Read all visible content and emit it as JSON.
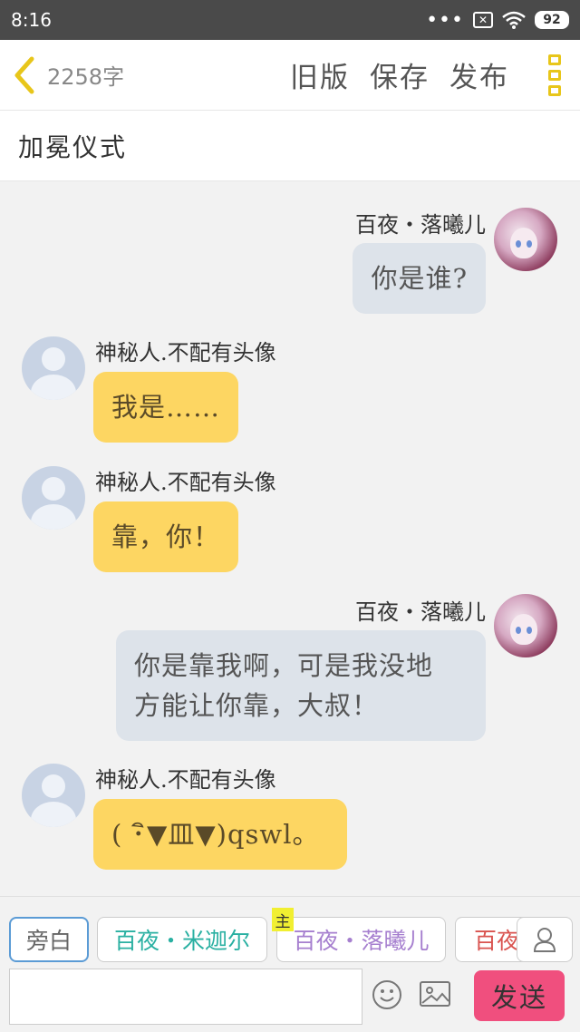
{
  "status_bar": {
    "time": "8:16",
    "battery": "92"
  },
  "header": {
    "word_count": "2258字",
    "old_version": "旧版",
    "save": "保存",
    "publish": "发布"
  },
  "title": "加冕仪式",
  "messages": [
    {
      "side": "right",
      "speaker": "百夜・落曦儿",
      "text": "你是谁?"
    },
    {
      "side": "left",
      "speaker": "神秘人.不配有头像",
      "text": "我是……"
    },
    {
      "side": "left",
      "speaker": "神秘人.不配有头像",
      "text": "靠，你！"
    },
    {
      "side": "right",
      "speaker": "百夜・落曦儿",
      "text_line1": "你是靠我啊，可是我没地",
      "text_line2": "方能让你靠，大叔！"
    },
    {
      "side": "left",
      "speaker": "神秘人.不配有头像",
      "text": "( ･ิ▼皿▼)qswl。"
    }
  ],
  "roles": {
    "narration": "旁白",
    "role_a": "百夜・米迦尔",
    "role_b": "百夜・落曦儿",
    "role_c": "百夜",
    "main_tag": "主"
  },
  "input": {
    "placeholder": "",
    "send": "发送"
  },
  "colors": {
    "accent_yellow": "#e8c61a",
    "bubble_yellow": "#fdd662",
    "bubble_blue": "#dde3ea",
    "send_pink": "#f04f7e",
    "role_teal": "#2ab0a2",
    "role_purple": "#a67fcf",
    "role_red": "#d9534f"
  }
}
